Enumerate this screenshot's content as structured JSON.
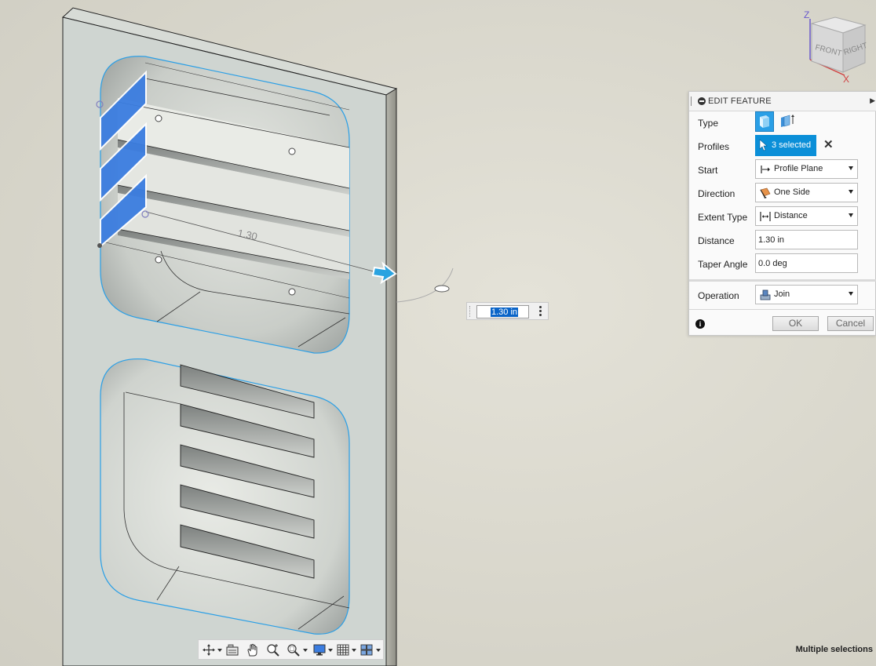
{
  "viewcube": {
    "axis_z": "Z",
    "axis_x": "X",
    "face_front": "FRONT",
    "face_right": "RIGHT"
  },
  "canvas": {
    "dimension_label": "1.30"
  },
  "panel": {
    "title": "EDIT FEATURE",
    "rows": {
      "type": {
        "label": "Type"
      },
      "profiles": {
        "label": "Profiles",
        "value": "3 selected"
      },
      "start": {
        "label": "Start",
        "value": "Profile Plane"
      },
      "direction": {
        "label": "Direction",
        "value": "One Side"
      },
      "extent_type": {
        "label": "Extent Type",
        "value": "Distance"
      },
      "distance": {
        "label": "Distance",
        "value": "1.30 in"
      },
      "taper_angle": {
        "label": "Taper Angle",
        "value": "0.0 deg"
      },
      "operation": {
        "label": "Operation",
        "value": "Join"
      }
    },
    "ok_label": "OK",
    "cancel_label": "Cancel"
  },
  "distance_input": {
    "value": "1.30 in"
  },
  "status": {
    "text": "Multiple selections"
  },
  "colors": {
    "accent": "#0b8fd8",
    "profile_blue": "#3b7de0",
    "edge_blue": "#2a9fe6"
  }
}
